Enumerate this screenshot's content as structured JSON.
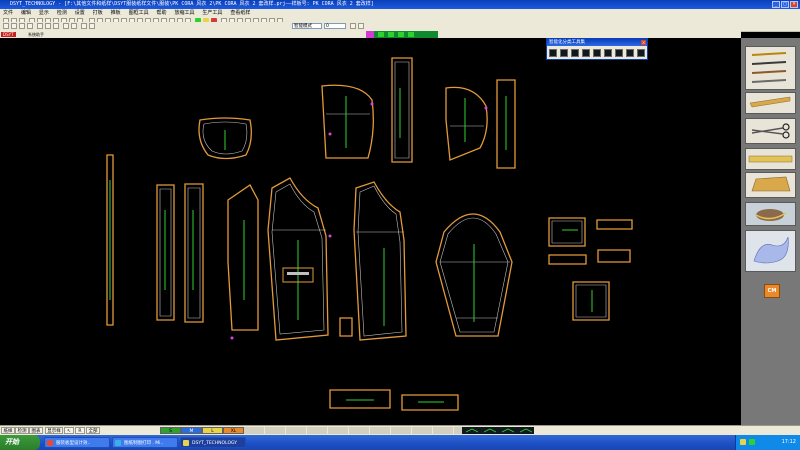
{
  "window": {
    "title": "DSYT_TECHNOLOGY - [F:\\其他文件和纸样\\DSYT服装纸样文件\\服装\\PK CORA 风衣 2\\PK CORA 风衣 2 套改样.prj——样板号: PK CORA 风衣 2 套改样]",
    "minimize": "_",
    "maximize": "□",
    "close": "×"
  },
  "menu": [
    "文件",
    "编辑",
    "显示",
    "检测",
    "设置",
    "打板",
    "推板",
    "图框工具",
    "帮助",
    "放缩工具",
    "生产工具",
    "查看纸样"
  ],
  "toolbar": {
    "mode_select": "智能模式",
    "value_input": "0"
  },
  "status_strip": {
    "left_tag": "DSYT",
    "mode_label": "系统助手"
  },
  "float_toolbar": {
    "title": "智能化分类工具集",
    "close": "×",
    "buttons": [
      "A",
      "B",
      "C",
      "D",
      "E",
      "F",
      "G",
      "H",
      "I"
    ]
  },
  "bottom_bar": {
    "buttons": [
      "纸样",
      "检测",
      "图表",
      "显示样",
      "↖",
      "R",
      "全部"
    ],
    "sizes": [
      "S",
      "M",
      "L",
      "XL"
    ],
    "size_colors": [
      "#2ea02e",
      "#2b6ce0",
      "#e8d34a",
      "#e88a2a"
    ]
  },
  "taskbar": {
    "start": "开始",
    "tasks": [
      "服装板型设计效..",
      "图纸制图打印 . Mi..",
      "DSYT_TECHNOLOGY"
    ],
    "clock": "17:12"
  },
  "colors": {
    "pattern_outline": "#e39a3a",
    "inner_line": "#ffffff",
    "grain_line": "#2ed12e",
    "accent_pink": "#e040e0",
    "title_blue": "#0a3fb8"
  }
}
